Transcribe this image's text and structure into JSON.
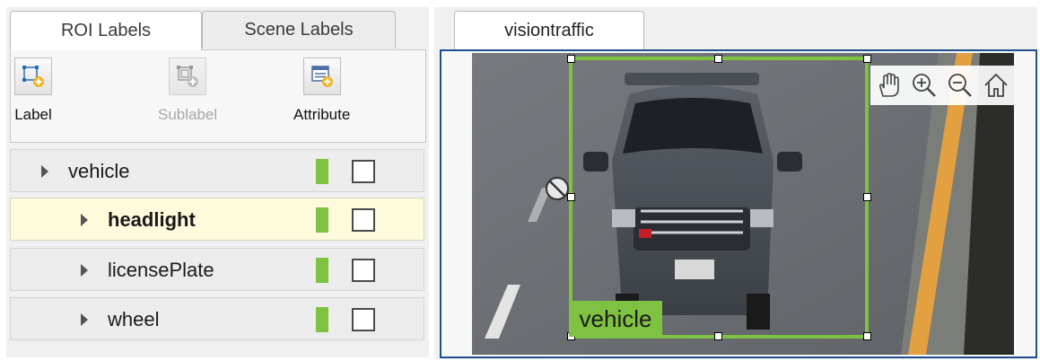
{
  "tabs": {
    "roi_labels": "ROI Labels",
    "scene_labels": "Scene Labels"
  },
  "toolbar": {
    "label": "Label",
    "sublabel": "Sublabel",
    "attribute": "Attribute"
  },
  "labels": [
    {
      "name": "vehicle",
      "color": "#7fc241",
      "selected": false,
      "level": 0
    },
    {
      "name": "headlight",
      "color": "#7fc241",
      "selected": true,
      "level": 1
    },
    {
      "name": "licensePlate",
      "color": "#7fc241",
      "selected": false,
      "level": 1
    },
    {
      "name": "wheel",
      "color": "#7fc241",
      "selected": false,
      "level": 1
    }
  ],
  "viewer": {
    "tab_label": "visiontraffic",
    "roi_label": "vehicle",
    "roi_color": "#7fc241",
    "tools": [
      "pan-hand-icon",
      "zoom-in-icon",
      "zoom-out-icon",
      "home-icon"
    ]
  }
}
